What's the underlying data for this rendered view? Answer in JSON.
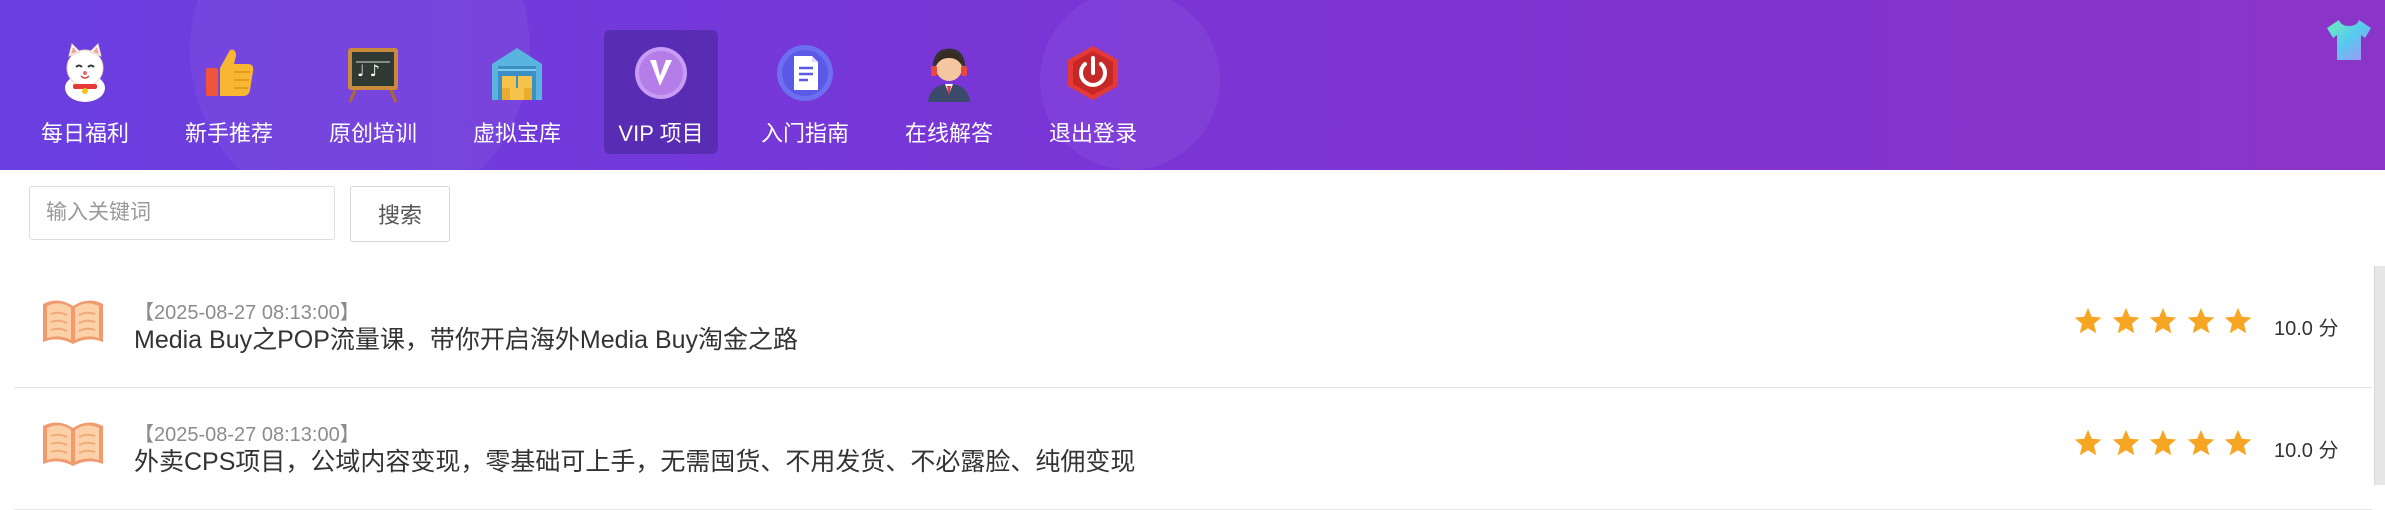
{
  "nav": {
    "items": [
      {
        "label": "每日福利",
        "icon": "lucky-cat-icon"
      },
      {
        "label": "新手推荐",
        "icon": "thumbs-up-icon"
      },
      {
        "label": "原创培训",
        "icon": "chalkboard-icon"
      },
      {
        "label": "虚拟宝库",
        "icon": "warehouse-icon"
      },
      {
        "label": "VIP 项目",
        "icon": "vip-badge-icon",
        "active": true
      },
      {
        "label": "入门指南",
        "icon": "document-icon"
      },
      {
        "label": "在线解答",
        "icon": "support-agent-icon"
      },
      {
        "label": "退出登录",
        "icon": "power-icon"
      }
    ],
    "skin_icon": "tshirt-icon"
  },
  "search": {
    "placeholder": "输入关键词",
    "value": "",
    "button_label": "搜索"
  },
  "list": {
    "items": [
      {
        "date": "【2025-08-27 08:13:00】",
        "title": "Media Buy之POP流量课，带你开启海外Media Buy淘金之路",
        "rating": 5,
        "score": "10.0 分",
        "icon": "open-book-icon"
      },
      {
        "date": "【2025-08-27 08:13:00】",
        "title": "外卖CPS项目，公域内容变现，零基础可上手，无需囤货、不用发货、不必露脸、纯佣变现",
        "rating": 5,
        "score": "10.0 分",
        "icon": "open-book-icon"
      }
    ]
  },
  "colors": {
    "header_start": "#6a3fe0",
    "header_end": "#8b34c8",
    "star": "#f6a623",
    "book": "#f4a97a"
  }
}
